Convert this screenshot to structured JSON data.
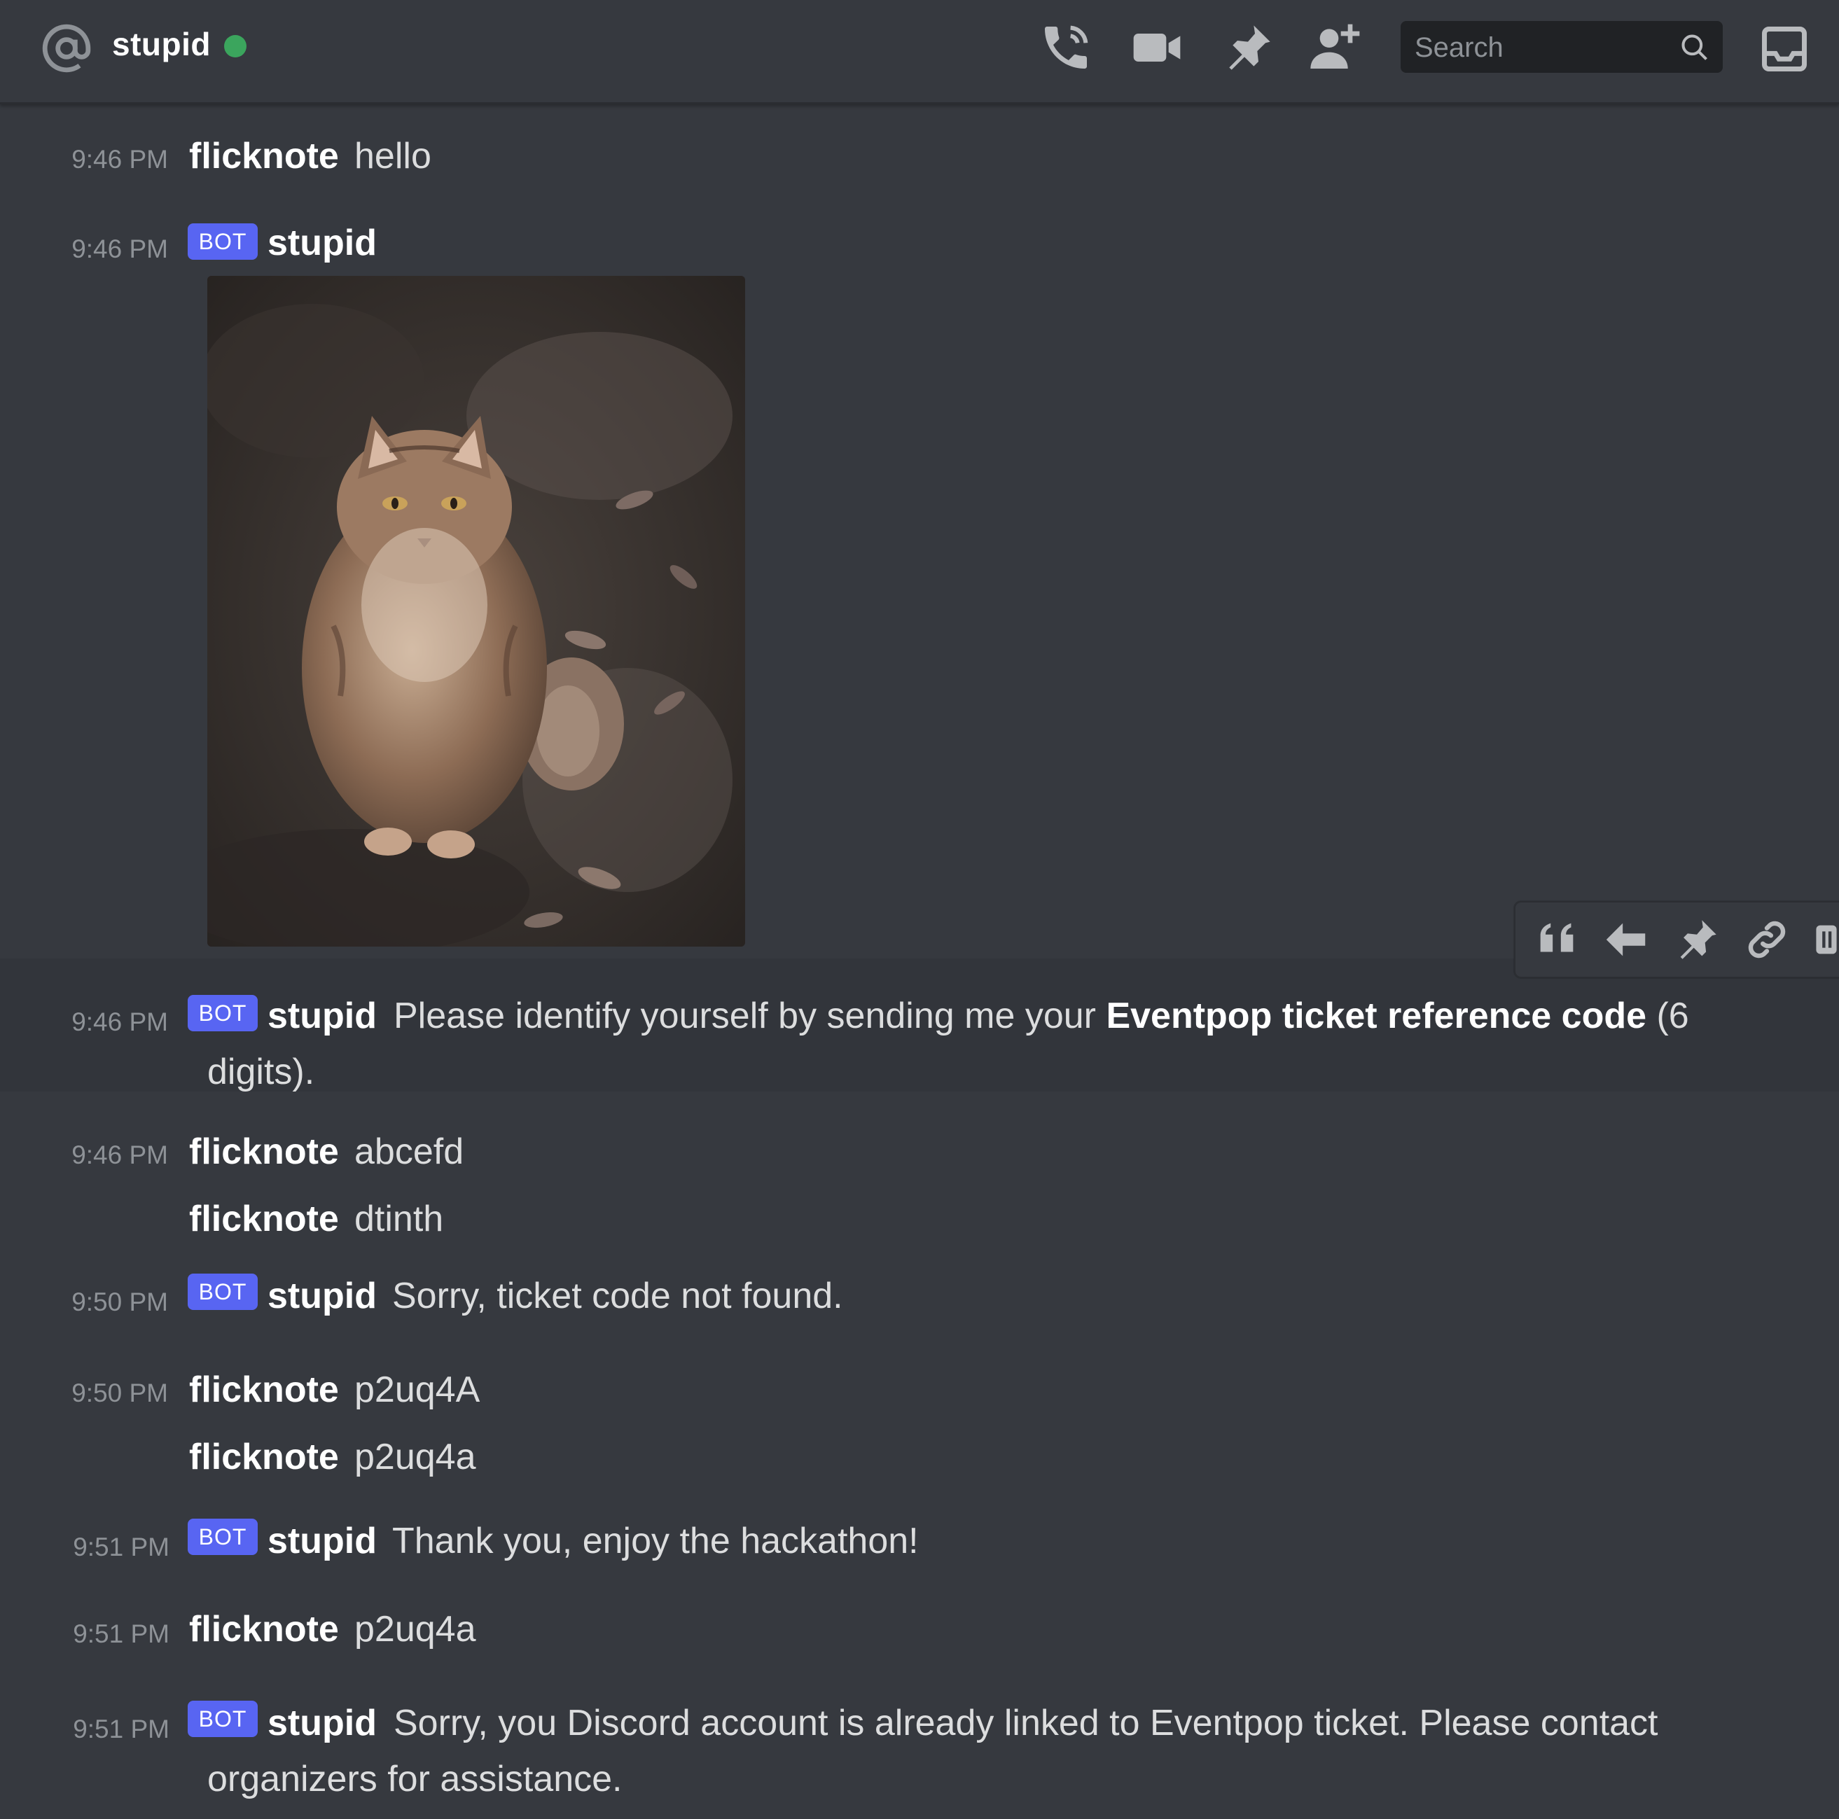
{
  "header": {
    "title": "stupid",
    "status": "online",
    "search_placeholder": "Search",
    "icons": [
      "at-icon",
      "phone-call-icon",
      "video-camera-icon",
      "pin-icon",
      "add-friend-icon",
      "search-icon",
      "inbox-icon"
    ]
  },
  "colors": {
    "background": "#36393f",
    "bot_tag": "#5865f2",
    "online": "#3ba55d",
    "timestamp": "#8e9297",
    "text": "#dcddde"
  },
  "messages": [
    {
      "time": "9:46 PM",
      "author": "flicknote",
      "text": "hello"
    },
    {
      "time": "9:46 PM",
      "author": "stupid",
      "bot_label": "BOT",
      "attachment": "cat-photo"
    },
    {
      "time": "9:46 PM",
      "author": "stupid",
      "bot_label": "BOT",
      "text_before": "Please identify yourself by sending me your ",
      "text_bold": "Eventpop ticket reference code",
      "text_after": " (6 digits)."
    },
    {
      "time": "9:46 PM",
      "author": "flicknote",
      "text": "abcefd"
    },
    {
      "author": "flicknote",
      "text": "dtinth"
    },
    {
      "time": "9:50 PM",
      "author": "stupid",
      "bot_label": "BOT",
      "text": "Sorry, ticket code not found."
    },
    {
      "time": "9:50 PM",
      "author": "flicknote",
      "text": "p2uq4A"
    },
    {
      "author": "flicknote",
      "text": "p2uq4a"
    },
    {
      "time": "9:51 PM",
      "author": "stupid",
      "bot_label": "BOT",
      "text": "Thank you, enjoy the hackathon!"
    },
    {
      "time": "9:51 PM",
      "author": "flicknote",
      "text": "p2uq4a"
    },
    {
      "time": "9:51 PM",
      "author": "stupid",
      "bot_label": "BOT",
      "text": "Sorry, you Discord account is already linked to Eventpop ticket. Please contact organizers for assistance."
    }
  ],
  "message_toolbar": {
    "icons": [
      "quote-icon",
      "reply-icon",
      "pin-icon",
      "copy-link-icon",
      "more-icon"
    ]
  }
}
